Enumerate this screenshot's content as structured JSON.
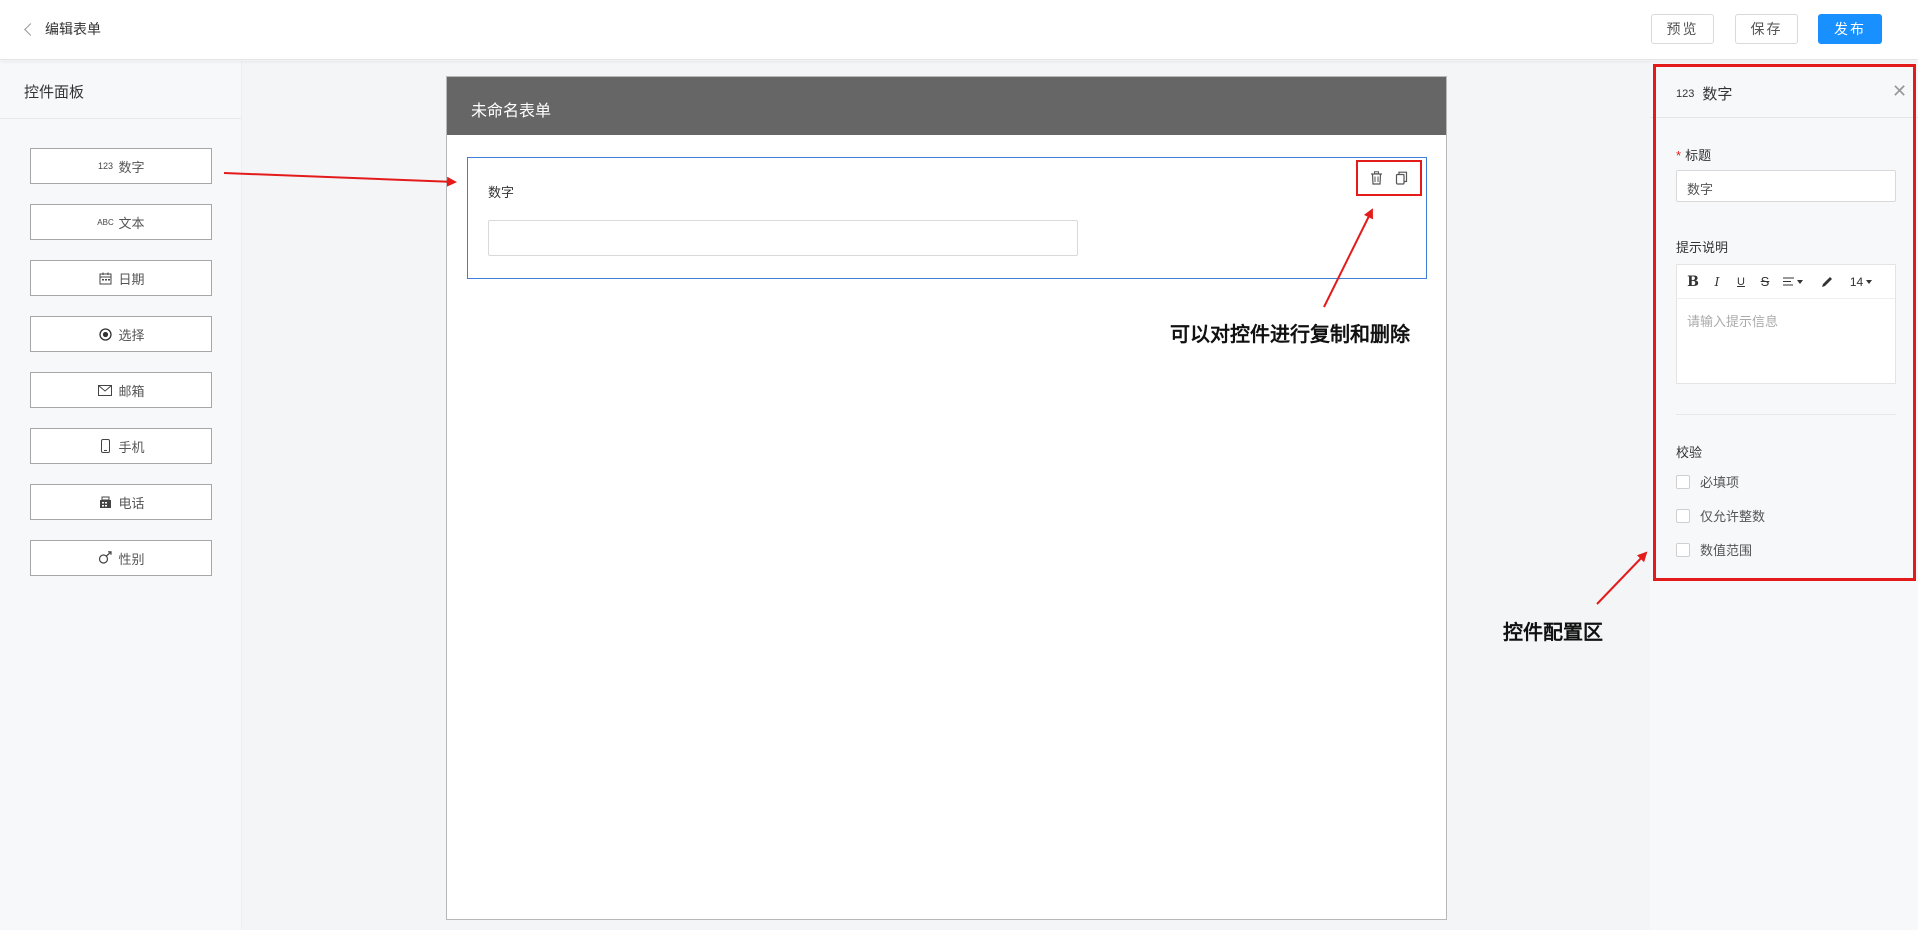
{
  "header": {
    "back_label": "编辑表单",
    "preview_label": "预览",
    "save_label": "保存",
    "publish_label": "发布",
    "accent_color": "#1890ff"
  },
  "left_panel": {
    "title": "控件面板",
    "widgets": [
      {
        "icon": "number-123-icon",
        "icon_text": "123",
        "label": "数字"
      },
      {
        "icon": "text-abc-icon",
        "icon_text": "ABC",
        "label": "文本"
      },
      {
        "icon": "calendar-icon",
        "icon_text": "",
        "label": "日期"
      },
      {
        "icon": "radio-icon",
        "icon_text": "",
        "label": "选择"
      },
      {
        "icon": "envelope-icon",
        "icon_text": "",
        "label": "邮箱"
      },
      {
        "icon": "mobile-phone-icon",
        "icon_text": "",
        "label": "手机"
      },
      {
        "icon": "telephone-icon",
        "icon_text": "",
        "label": "电话"
      },
      {
        "icon": "gender-icon",
        "icon_text": "",
        "label": "性别"
      }
    ]
  },
  "form": {
    "title": "未命名表单",
    "field": {
      "label": "数字",
      "actions": [
        "delete-icon",
        "copy-icon"
      ]
    }
  },
  "annotations": {
    "copy_delete_note": "可以对控件进行复制和删除",
    "config_note": "控件配置区",
    "highlight_color": "#e31b1b"
  },
  "config_panel": {
    "icon_text": "123",
    "title": "数字",
    "close_icon": "close-icon",
    "title_label": "标题",
    "title_value": "数字",
    "hint_label": "提示说明",
    "font_size_value": "14",
    "hint_placeholder": "请输入提示信息",
    "validation_label": "校验",
    "checkboxes": [
      "必填项",
      "仅允许整数",
      "数值范围"
    ]
  }
}
